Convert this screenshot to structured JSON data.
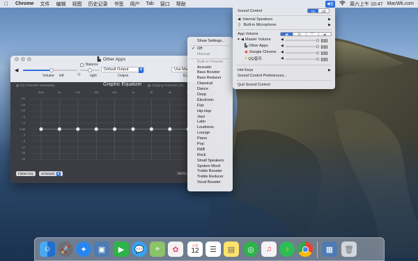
{
  "menubar": {
    "apple_icon": "apple-icon",
    "app_name": "Chrome",
    "items": [
      "文件",
      "编辑",
      "视图",
      "历史记录",
      "书签",
      "用户",
      "Tab",
      "窗口",
      "帮助"
    ],
    "clock": "周六上午 10:47",
    "site": "MacWk.com"
  },
  "eq_window": {
    "title": "Other Apps",
    "balance_label": "Balance",
    "volume_label": "Volume",
    "left_label": "left",
    "right_label": "right",
    "output_select": "Default Output",
    "output_label": "Output",
    "use_master_label": "Use Mas",
    "eq_label": "EQ",
    "panel_title": "Graphic Equalizer",
    "eq_channels_label": "EQ Channels Separately",
    "clipping_label": "Clipping Protection (R)",
    "freqs": [
      "31Hz",
      "64",
      "125",
      "250",
      "500",
      "1k",
      "2k",
      "4k",
      "8k"
    ],
    "db_ticks": [
      "+20",
      "+16",
      "+12",
      "+8",
      "+4",
      "0 dB",
      "-4",
      "-8",
      "-12",
      "-16",
      "-20"
    ],
    "band_gains": [
      0,
      0,
      0,
      0,
      0,
      0,
      0,
      0,
      0,
      0
    ],
    "flatten_label": "Flatten EQ",
    "bands_select": "10 Bands",
    "band_info": "16kHz Band"
  },
  "presets_menu": {
    "show_settings": "Show Settings...",
    "off": "Off",
    "manual": "Manual",
    "builtin_header": "Built-in Presets",
    "presets": [
      "Acoustic",
      "Bass Booster",
      "Bass Reducer",
      "Classical",
      "Dance",
      "Deep",
      "Electronic",
      "Flat",
      "Hip-Hop",
      "Jazz",
      "Latin",
      "Loudness",
      "Lounge",
      "Piano",
      "Pop",
      "R&B",
      "Rock",
      "Small Speakers",
      "Spoken Word",
      "Treble Booster",
      "Treble Reducer",
      "Vocal Booster"
    ]
  },
  "sound_menu": {
    "title": "Sound Control",
    "on_label": "On",
    "off_label": "Off",
    "internal_speakers": "Internal Speakers",
    "builtin_mic": "Built-in Microphone",
    "app_volume": "App Volume",
    "master_volume": "Master Volume",
    "apps": [
      "Other Apps",
      "Google Chrome",
      "QQ音乐"
    ],
    "hot_keys": "Hot Keys",
    "preferences": "Sound Control Preferences...",
    "quit": "Quit Sound Control",
    "seg_options": [
      "◀)",
      "|||",
      "⌒",
      "⇄"
    ]
  },
  "dock": {
    "apps": [
      "Finder",
      "Launchpad",
      "Safari",
      "Preview",
      "FaceTime",
      "Messages",
      "Maps",
      "Photos",
      "Calendar",
      "Reminders",
      "Notes",
      "Chrome Canary",
      "Music",
      "QQ音乐",
      "Google Chrome",
      "Screenshot",
      "Trash"
    ],
    "calendar_day": "12",
    "calendar_month": "12月"
  }
}
